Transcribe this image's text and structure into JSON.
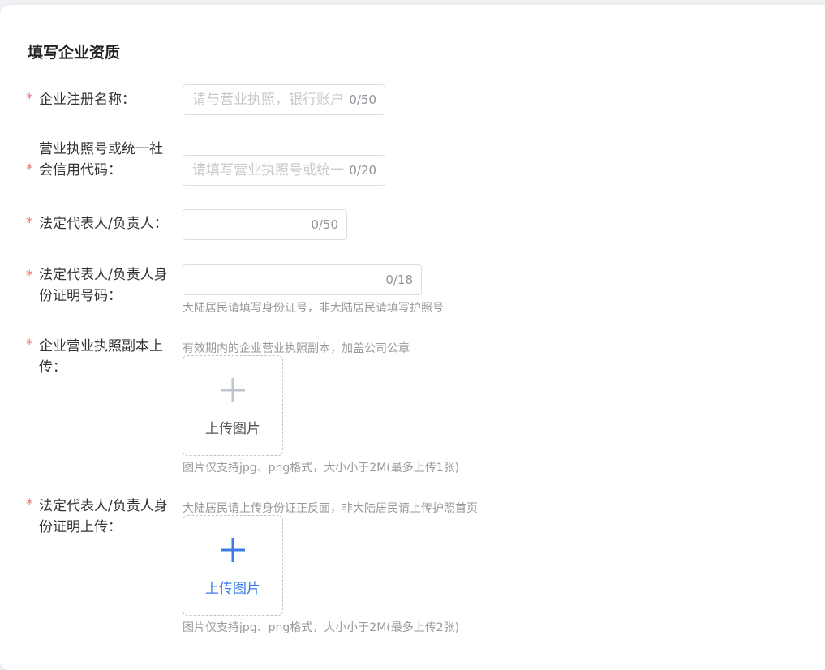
{
  "page": {
    "title": "填写企业资质"
  },
  "form": {
    "required_mark": "*",
    "company_name": {
      "label": "企业注册名称：",
      "placeholder": "请与营业执照，银行账户",
      "value": "",
      "count": "0/50"
    },
    "license_number": {
      "label_line1": "营业执照号或统一社",
      "label_line2": "会信用代码：",
      "placeholder": "请填写营业执照号或统一",
      "value": "",
      "count": "0/20"
    },
    "legal_rep": {
      "label": "法定代表人/负责人：",
      "placeholder": "",
      "value": "",
      "count": "0/50"
    },
    "legal_rep_id": {
      "label_line1": "法定代表人/负责人身",
      "label_line2": "份证明号码：",
      "placeholder": "",
      "value": "",
      "count": "0/18",
      "hint": "大陆居民请填写身份证号，非大陆居民请填写护照号"
    },
    "license_upload": {
      "label_line1": "企业营业执照副本上",
      "label_line2": "传：",
      "hint_top": "有效期内的企业营业执照副本，加盖公司公章",
      "button_label": "上传图片",
      "hint_bottom": "图片仅支持jpg、png格式，大小小于2M(最多上传1张)"
    },
    "id_upload": {
      "label_line1": "法定代表人/负责人身",
      "label_line2": "份证明上传：",
      "hint_top": "大陆居民请上传身份证正反面，非大陆居民请上传护照首页",
      "button_label": "上传图片",
      "hint_bottom": "图片仅支持jpg、png格式，大小小于2M(最多上传2张)"
    }
  },
  "colors": {
    "required": "#f56c6c",
    "upload_inactive_plus": "#c0c4cc",
    "upload_active": "#3a7be8",
    "border": "#dcdfe6",
    "hint": "#999999"
  },
  "icons": {
    "upload_plus": "plus-icon"
  }
}
